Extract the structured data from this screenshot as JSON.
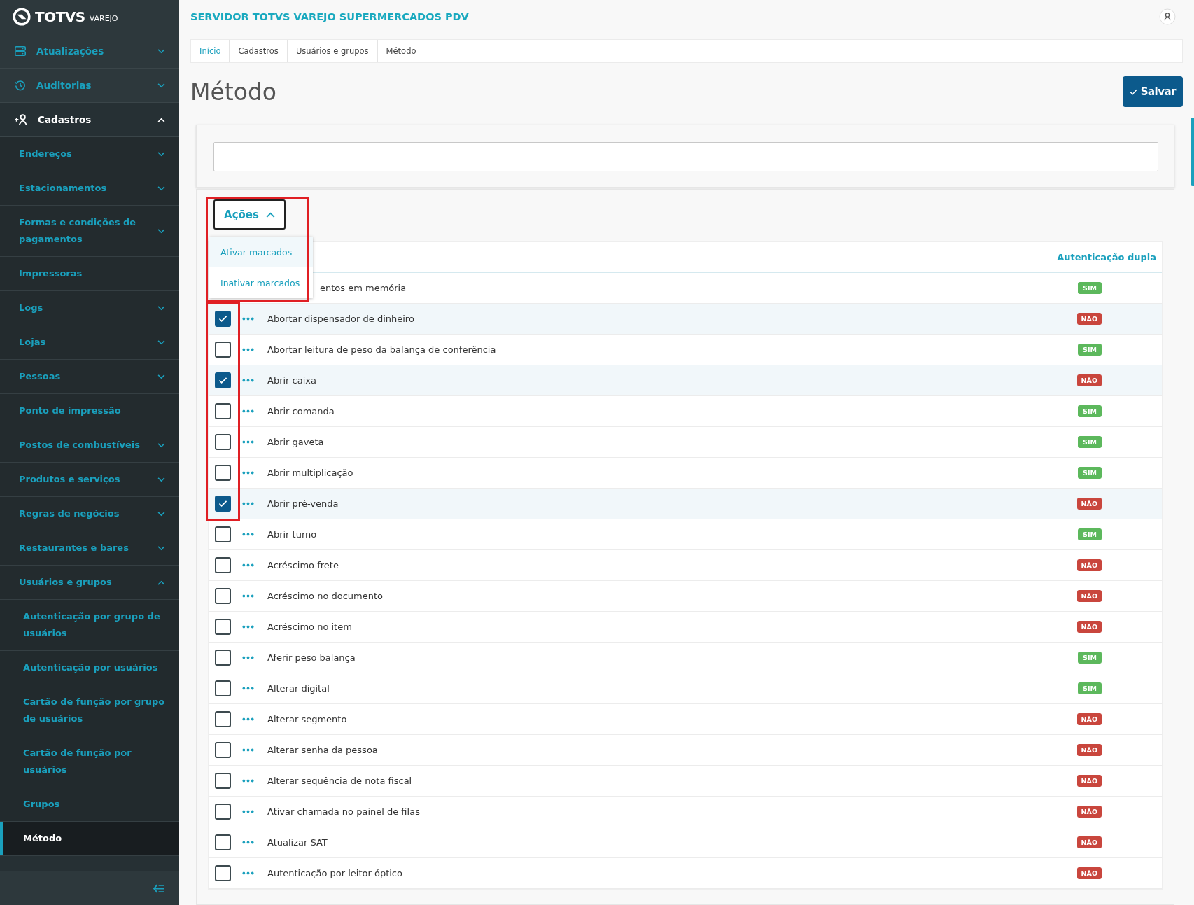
{
  "sidebar": {
    "brand": "TOTVS",
    "brand_sub": "VAREJO",
    "items": [
      {
        "label": "Atualizações",
        "expanded": false
      },
      {
        "label": "Auditorias",
        "expanded": false
      },
      {
        "label": "Cadastros",
        "expanded": true,
        "children": [
          {
            "label": "Endereços",
            "expanded": false,
            "selected": false
          },
          {
            "label": "Estacionamentos",
            "expanded": false,
            "selected": false
          },
          {
            "label": "Formas e condições de pagamentos",
            "expanded": false,
            "selected": false
          },
          {
            "label": "Impressoras",
            "selected": false
          },
          {
            "label": "Logs",
            "expanded": false,
            "selected": false
          },
          {
            "label": "Lojas",
            "expanded": false,
            "selected": false
          },
          {
            "label": "Pessoas",
            "expanded": false,
            "selected": false
          },
          {
            "label": "Ponto de impressão",
            "selected": false
          },
          {
            "label": "Postos de combustíveis",
            "expanded": false,
            "selected": false
          },
          {
            "label": "Produtos e serviços",
            "expanded": false,
            "selected": false
          },
          {
            "label": "Regras de negócios",
            "expanded": false,
            "selected": false
          },
          {
            "label": "Restaurantes e bares",
            "expanded": false,
            "selected": false
          },
          {
            "label": "Usuários e grupos",
            "expanded": true,
            "selected": false,
            "children": [
              {
                "label": "Autenticação por grupo de usuários",
                "selected": false
              },
              {
                "label": "Autenticação por usuários",
                "selected": false
              },
              {
                "label": "Cartão de função por grupo de usuários",
                "selected": false
              },
              {
                "label": "Cartão de função por usuários",
                "selected": false
              },
              {
                "label": "Grupos",
                "selected": false
              },
              {
                "label": "Método",
                "selected": true
              }
            ]
          }
        ]
      }
    ]
  },
  "header": {
    "title": "SERVIDOR TOTVS VAREJO SUPERMERCADOS PDV"
  },
  "breadcrumb": [
    "Início",
    "Cadastros",
    "Usuários e grupos",
    "Método"
  ],
  "page_title": "Método",
  "save_button": "Salvar",
  "actions": {
    "label": "Ações",
    "expanded": true,
    "highlighted": true,
    "items": [
      {
        "label": "Ativar marcados",
        "selected": true
      },
      {
        "label": "Inativar marcados",
        "selected": false
      }
    ]
  },
  "table": {
    "auth_column": "Autenticação dupla",
    "rows": [
      {
        "name": "entos em memória",
        "auth": "SIM",
        "color": "#5cb85c"
      },
      {
        "name": "Abortar dispensador de dinheiro",
        "checked": true,
        "highlighted": true,
        "auth": "NÃO",
        "color": "#c9463d"
      },
      {
        "name": "Abortar leitura de peso da balança de conferência",
        "checked": false,
        "highlighted": true,
        "auth": "SIM",
        "color": "#5cb85c"
      },
      {
        "name": "Abrir caixa",
        "checked": true,
        "highlighted": true,
        "auth": "NÃO",
        "color": "#c9463d"
      },
      {
        "name": "Abrir comanda",
        "checked": false,
        "highlighted": true,
        "auth": "SIM",
        "color": "#5cb85c"
      },
      {
        "name": "Abrir gaveta",
        "checked": false,
        "highlighted": true,
        "auth": "SIM",
        "color": "#5cb85c"
      },
      {
        "name": "Abrir multiplicação",
        "checked": false,
        "highlighted": true,
        "auth": "SIM",
        "color": "#5cb85c"
      },
      {
        "name": "Abrir pré-venda",
        "checked": true,
        "highlighted": true,
        "auth": "NÃO",
        "color": "#c9463d"
      },
      {
        "name": "Abrir turno",
        "checked": false,
        "highlighted": false,
        "auth": "SIM",
        "color": "#5cb85c"
      },
      {
        "name": "Acréscimo frete",
        "checked": false,
        "highlighted": false,
        "auth": "NÃO",
        "color": "#c9463d"
      },
      {
        "name": "Acréscimo no documento",
        "checked": false,
        "highlighted": false,
        "auth": "NÃO",
        "color": "#c9463d"
      },
      {
        "name": "Acréscimo no item",
        "checked": false,
        "highlighted": false,
        "auth": "NÃO",
        "color": "#c9463d"
      },
      {
        "name": "Aferir peso balança",
        "checked": false,
        "highlighted": false,
        "auth": "SIM",
        "color": "#5cb85c"
      },
      {
        "name": "Alterar digital",
        "checked": false,
        "highlighted": false,
        "auth": "SIM",
        "color": "#5cb85c"
      },
      {
        "name": "Alterar segmento",
        "checked": false,
        "highlighted": false,
        "auth": "NÃO",
        "color": "#c9463d"
      },
      {
        "name": "Alterar senha da pessoa",
        "checked": false,
        "highlighted": false,
        "auth": "NÃO",
        "color": "#c9463d"
      },
      {
        "name": "Alterar sequência de nota fiscal",
        "checked": false,
        "highlighted": false,
        "auth": "NÃO",
        "color": "#c9463d"
      },
      {
        "name": "Ativar chamada no painel de filas",
        "checked": false,
        "highlighted": false,
        "auth": "NÃO",
        "color": "#c9463d"
      },
      {
        "name": "Atualizar SAT",
        "checked": false,
        "highlighted": false,
        "auth": "NÃO",
        "color": "#c9463d"
      },
      {
        "name": "Autenticação por leitor óptico",
        "checked": false,
        "highlighted": false,
        "auth": "NÃO",
        "color": "#c9463d"
      }
    ]
  }
}
